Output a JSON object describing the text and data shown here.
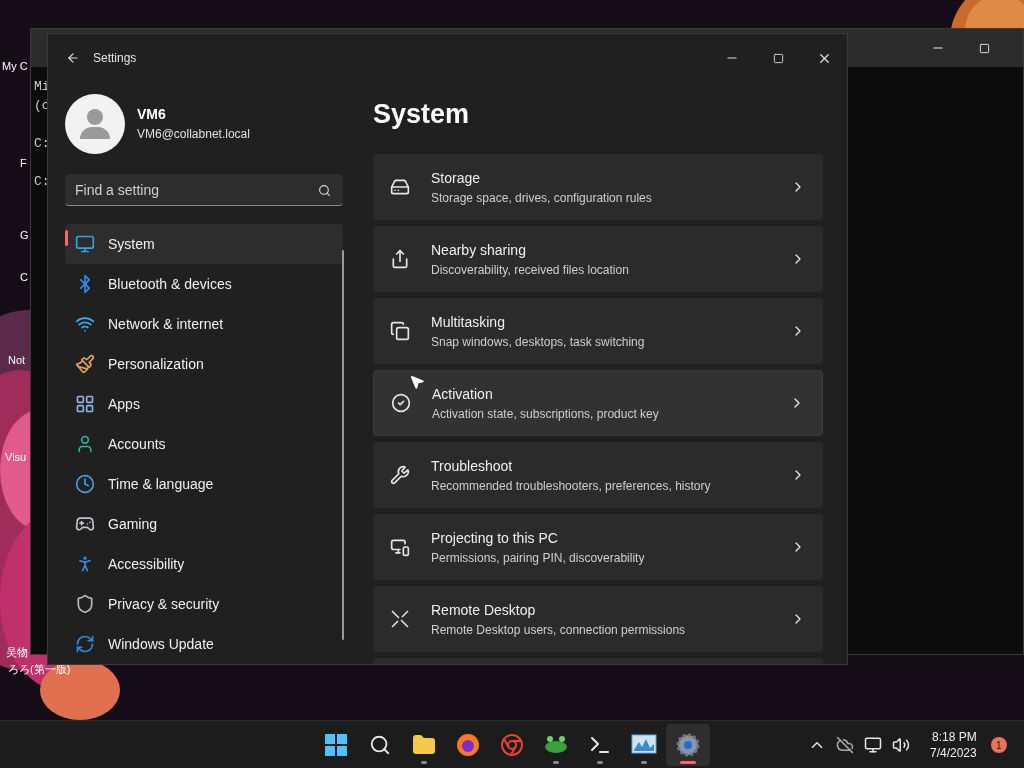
{
  "desktop_icons": [
    {
      "label": "My C"
    },
    {
      "label": "F"
    },
    {
      "label": "G"
    },
    {
      "label": "C"
    },
    {
      "label": "Not"
    },
    {
      "label": "Visu"
    },
    {
      "label": "吴物"
    },
    {
      "label": "ろろ(第一版)"
    }
  ],
  "terminal": {
    "lines": [
      "Mi",
      "(c",
      "C:",
      "C:"
    ]
  },
  "settings": {
    "title": "Settings",
    "user": {
      "name": "VM6",
      "email": "VM6@collabnet.local"
    },
    "search": {
      "placeholder": "Find a setting"
    },
    "nav": [
      {
        "label": "System",
        "selected": true
      },
      {
        "label": "Bluetooth & devices",
        "selected": false
      },
      {
        "label": "Network & internet",
        "selected": false
      },
      {
        "label": "Personalization",
        "selected": false
      },
      {
        "label": "Apps",
        "selected": false
      },
      {
        "label": "Accounts",
        "selected": false
      },
      {
        "label": "Time & language",
        "selected": false
      },
      {
        "label": "Gaming",
        "selected": false
      },
      {
        "label": "Accessibility",
        "selected": false
      },
      {
        "label": "Privacy & security",
        "selected": false
      },
      {
        "label": "Windows Update",
        "selected": false
      }
    ],
    "page_title": "System",
    "cards": [
      {
        "title": "Storage",
        "subtitle": "Storage space, drives, configuration rules",
        "hovered": false
      },
      {
        "title": "Nearby sharing",
        "subtitle": "Discoverability, received files location",
        "hovered": false
      },
      {
        "title": "Multitasking",
        "subtitle": "Snap windows, desktops, task switching",
        "hovered": false
      },
      {
        "title": "Activation",
        "subtitle": "Activation state, subscriptions, product key",
        "hovered": true
      },
      {
        "title": "Troubleshoot",
        "subtitle": "Recommended troubleshooters, preferences, history",
        "hovered": false
      },
      {
        "title": "Projecting to this PC",
        "subtitle": "Permissions, pairing PIN, discoverability",
        "hovered": false
      },
      {
        "title": "Remote Desktop",
        "subtitle": "Remote Desktop users, connection permissions",
        "hovered": false
      }
    ]
  },
  "taskbar": {
    "apps": [
      {
        "running": false,
        "selected": false
      },
      {
        "running": false,
        "selected": false
      },
      {
        "running": true,
        "selected": false
      },
      {
        "running": false,
        "selected": false
      },
      {
        "running": false,
        "selected": false
      },
      {
        "running": true,
        "selected": false
      },
      {
        "running": true,
        "selected": false
      },
      {
        "running": true,
        "selected": false
      },
      {
        "running": true,
        "selected": true
      }
    ],
    "time": "8:18 PM",
    "date": "7/4/2023",
    "notification_count": "1"
  }
}
